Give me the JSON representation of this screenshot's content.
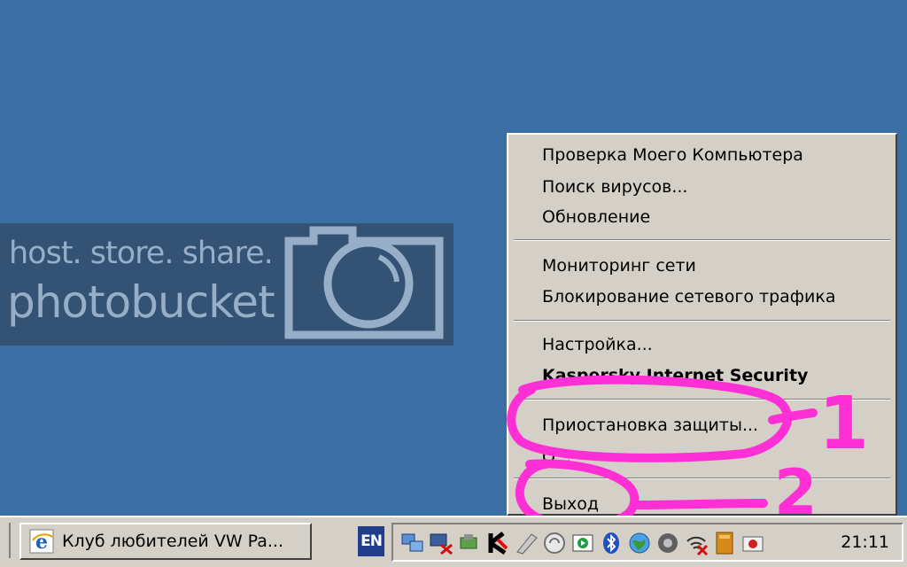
{
  "watermark": {
    "line1": "host. store. share.",
    "line2": "photobucket"
  },
  "menu": {
    "items": [
      {
        "label": "Проверка Моего Компьютера"
      },
      {
        "label": "Поиск вирусов..."
      },
      {
        "label": "Обновление"
      },
      {
        "label": "Мониторинг сети"
      },
      {
        "label": "Блокирование сетевого трафика"
      },
      {
        "label": "Настройка..."
      },
      {
        "label": "Kaspersky Internet Security"
      },
      {
        "label": "Приостановка защиты..."
      },
      {
        "label": "О..."
      },
      {
        "label": "Выход"
      }
    ]
  },
  "annotations": {
    "mark1": "1",
    "mark2": "2",
    "color": "#ff2fd6"
  },
  "taskbar": {
    "task_label": "Клуб любителей VW Pa...",
    "lang": "EN",
    "clock": "21:11",
    "tray_icons": [
      "network-icon",
      "network-disconnected-icon",
      "usb-icon",
      "kaspersky-icon",
      "pen-icon",
      "sync-icon",
      "media-icon",
      "bluetooth-icon",
      "globe-icon",
      "speaker-icon",
      "wifi-disconnected-icon",
      "book-icon",
      "camera-icon"
    ]
  },
  "colors": {
    "desktop": "#3a6ea5",
    "menu_bg": "#d4d0c8",
    "taskbar_bg": "#d4d0c8"
  }
}
